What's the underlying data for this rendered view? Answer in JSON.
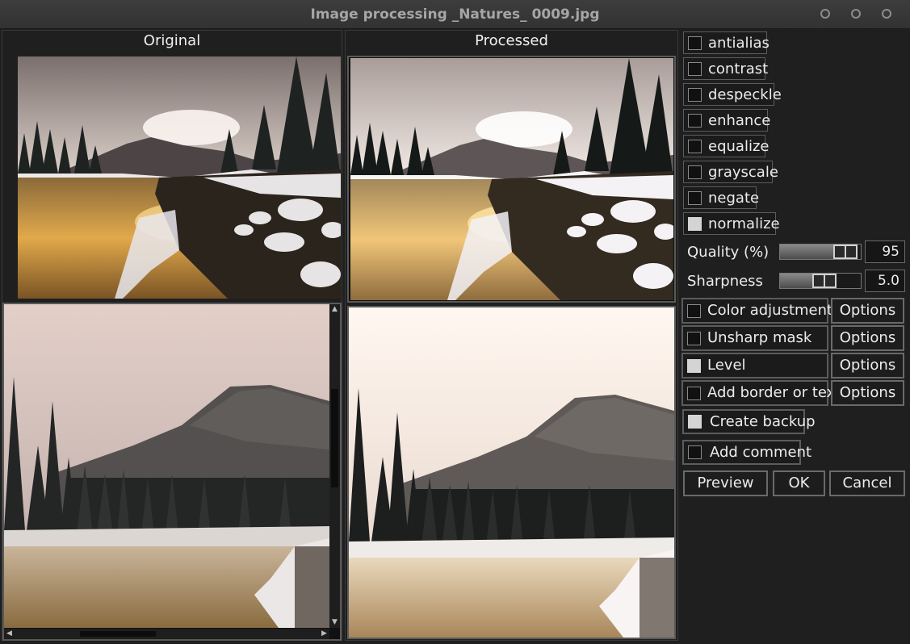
{
  "window": {
    "title": "Image processing _Natures_ 0009.jpg"
  },
  "panes": {
    "original_label": "Original",
    "processed_label": "Processed"
  },
  "options": [
    {
      "label": "antialias",
      "checked": false
    },
    {
      "label": "contrast",
      "checked": false
    },
    {
      "label": "despeckle",
      "checked": false
    },
    {
      "label": "enhance",
      "checked": false
    },
    {
      "label": "equalize",
      "checked": false
    },
    {
      "label": "grayscale",
      "checked": false
    },
    {
      "label": "negate",
      "checked": false
    },
    {
      "label": "normalize",
      "checked": true
    }
  ],
  "quality": {
    "label": "Quality (%)",
    "value": "95",
    "level": 0.95
  },
  "sharpness": {
    "label": "Sharpness",
    "value": "5.0",
    "level": 0.58
  },
  "filters": [
    {
      "label": "Color adjustment",
      "checked": false,
      "options_label": "Options"
    },
    {
      "label": "Unsharp mask",
      "checked": false,
      "options_label": "Options"
    },
    {
      "label": "Level",
      "checked": true,
      "options_label": "Options"
    },
    {
      "label": "Add border or text",
      "checked": false,
      "options_label": "Options"
    }
  ],
  "create_backup": {
    "label": "Create backup",
    "checked": true
  },
  "add_comment": {
    "label": "Add comment",
    "checked": false
  },
  "buttons": {
    "preview": "Preview",
    "ok": "OK",
    "cancel": "Cancel"
  }
}
